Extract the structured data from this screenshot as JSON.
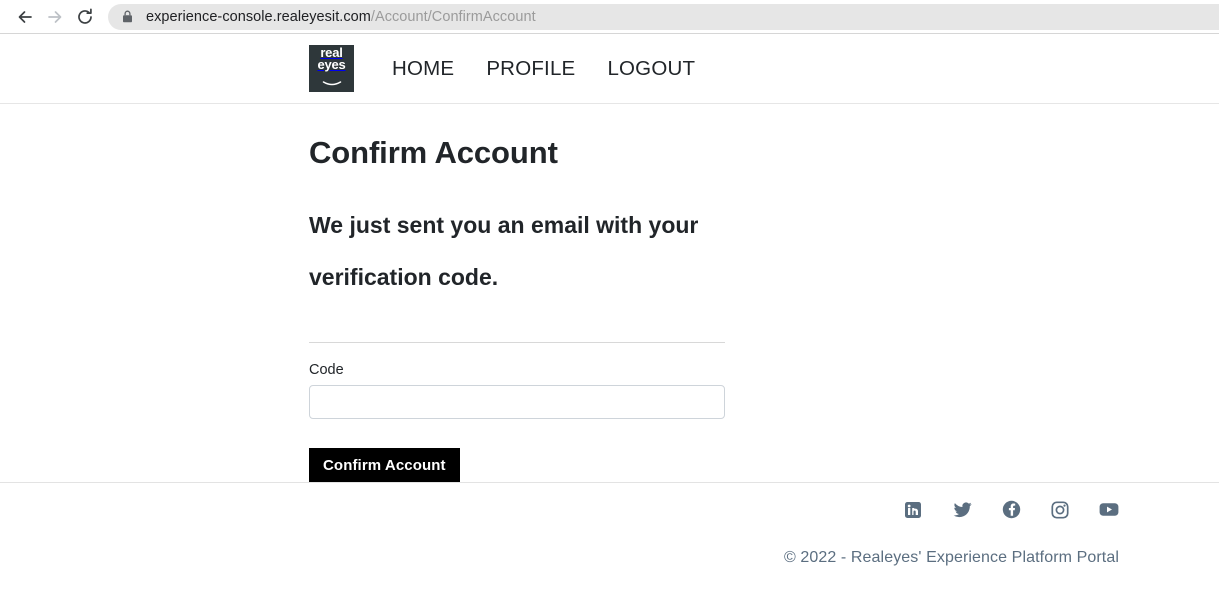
{
  "browser": {
    "back_icon": "back-arrow-icon",
    "forward_icon": "forward-arrow-icon",
    "reload_icon": "reload-icon",
    "lock_icon": "lock-icon",
    "url_host": "experience-console.realeyesit.com",
    "url_path": "/Account/ConfirmAccount"
  },
  "header": {
    "logo": {
      "line1": "real",
      "line2": "eyes",
      "background": "#2e373a"
    },
    "nav": [
      {
        "label": "HOME",
        "name": "nav-link-home"
      },
      {
        "label": "PROFILE",
        "name": "nav-link-profile"
      },
      {
        "label": "LOGOUT",
        "name": "nav-link-logout"
      }
    ]
  },
  "main": {
    "title": "Confirm Account",
    "subtitle": "We just sent you an email with your verification code.",
    "form": {
      "code_label": "Code",
      "code_value": "",
      "code_placeholder": "",
      "submit_label": "Confirm Account"
    }
  },
  "footer": {
    "social": [
      {
        "name": "linkedin-icon",
        "label": "LinkedIn"
      },
      {
        "name": "twitter-icon",
        "label": "Twitter"
      },
      {
        "name": "facebook-icon",
        "label": "Facebook"
      },
      {
        "name": "instagram-icon",
        "label": "Instagram"
      },
      {
        "name": "youtube-icon",
        "label": "YouTube"
      }
    ],
    "copyright": "© 2022 - Realeyes' Experience Platform Portal",
    "accent": "#5b6e80"
  }
}
